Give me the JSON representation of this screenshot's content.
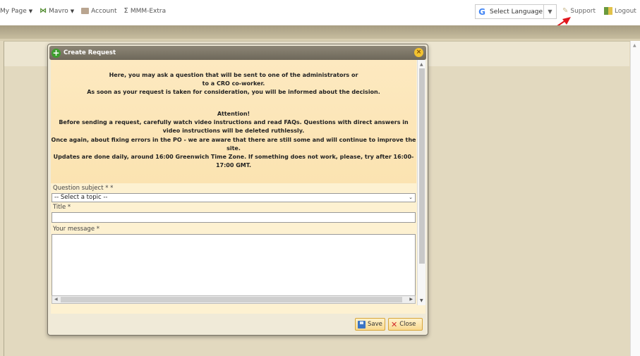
{
  "nav": {
    "my_page": "My Page",
    "mavro": "Mavro",
    "account": "Account",
    "mmm_extra": "MMM-Extra",
    "sigma_glyph": "Σ"
  },
  "language": {
    "label": "Select Language",
    "g_glyph": "G",
    "arrow_glyph": "▼"
  },
  "support": "Support",
  "logout": "Logout",
  "dialog": {
    "title": "Create Request",
    "plus_glyph": "+",
    "close_glyph": "×",
    "intro": [
      "Here, you may ask a question that will be sent to one of the administrators or",
      "to a CRO co-worker.",
      "As soon as your request is taken for consideration, you will be informed about the decision."
    ],
    "attention": [
      "Attention!",
      "Before sending a request, carefully watch video instructions and read FAQs. Questions with direct answers in",
      "video instructions will be deleted ruthlessly.",
      "Once again, about fixing errors in the PO - we are aware that there are still some and will continue to improve the",
      "site.",
      "Updates are done daily, around 16:00 Greenwich Time Zone. If something does not work, please, try after 16:00-",
      "17:00 GMT."
    ],
    "subject_label": "Question subject * *",
    "subject_value": "-- Select a topic --",
    "title_label": "Title *",
    "title_value": "",
    "message_label": "Your message *",
    "message_value": "",
    "save_label": "Save",
    "close_label": "Close"
  },
  "colors": {
    "accent_green": "#3d9e2e",
    "button_border": "#d7a53a",
    "notice_bg": "#fde9c0",
    "arrow_red": "#e0161c"
  },
  "icons": [
    "caret-down-icon",
    "mavro-icon",
    "account-icon",
    "sigma-icon",
    "google-icon",
    "pencil-icon",
    "logout-icon",
    "plus-icon",
    "close-icon",
    "save-icon",
    "close-x-icon"
  ]
}
